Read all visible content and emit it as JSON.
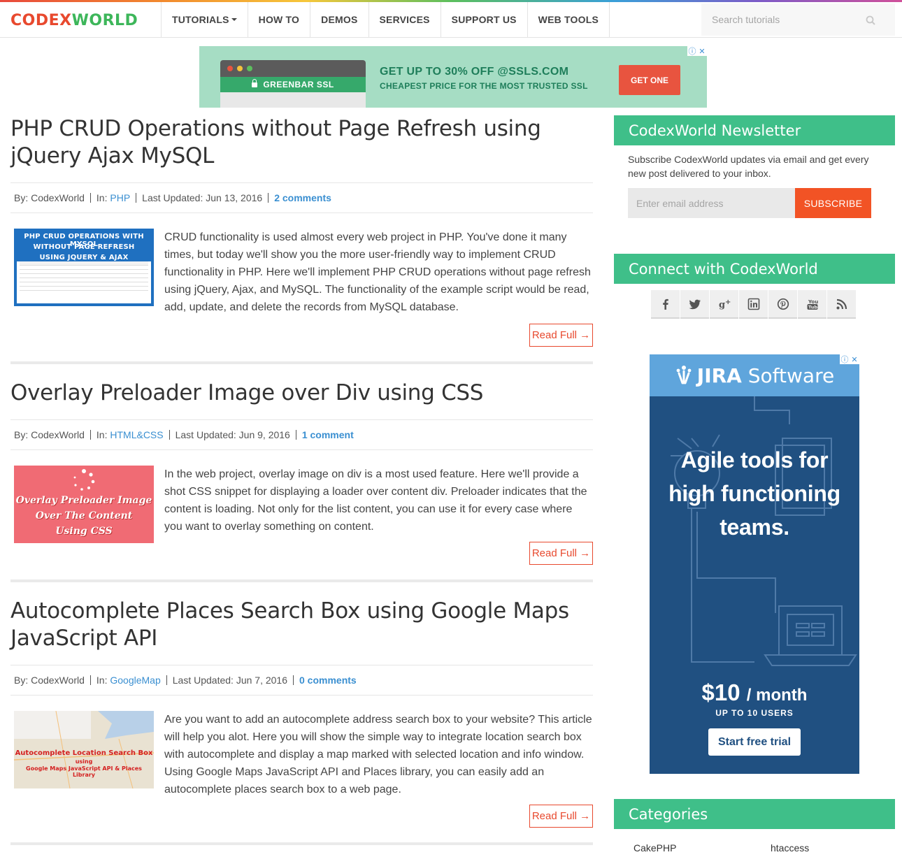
{
  "header": {
    "logo_part1": "CODEX",
    "logo_part2": "WORLD",
    "nav": [
      "TUTORIALS",
      "HOW TO",
      "DEMOS",
      "SERVICES",
      "SUPPORT US",
      "WEB TOOLS"
    ],
    "search_placeholder": "Search tutorials"
  },
  "top_ad": {
    "badge": "GREENBAR SSL",
    "headline": "GET UP TO 30% OFF @SSLS.COM",
    "subline": "CHEAPEST PRICE FOR THE MOST TRUSTED SSL",
    "cta": "GET ONE"
  },
  "posts": [
    {
      "title": "PHP CRUD Operations without Page Refresh using jQuery Ajax MySQL",
      "by_label": "By: CodexWorld",
      "in_label": "In:",
      "category": "PHP",
      "updated": "Last Updated: Jun 13, 2016",
      "comments": "2 comments",
      "excerpt": "CRUD functionality is used almost every web project in PHP. You've done it many times, but today we'll show you the more user-friendly way to implement CRUD functionality in PHP. Here we'll implement PHP CRUD operations without page refresh using jQuery, Ajax, and MySQL. The functionality of the example script would be read, add, update, and delete the records from MySQL database.",
      "thumb_lines": [
        "PHP CRUD OPERATIONS WITH MYSQL",
        "WITHOUT PAGE REFRESH",
        "USING JQUERY & AJAX"
      ],
      "read_more": "Read Full →"
    },
    {
      "title": "Overlay Preloader Image over Div using CSS",
      "by_label": "By: CodexWorld",
      "in_label": "In:",
      "category": "HTML&CSS",
      "updated": "Last Updated: Jun 9, 2016",
      "comments": "1 comment",
      "excerpt": "In the web project, overlay image on div is a most used feature. Here we'll provide a shot CSS snippet for displaying a loader over content div. Preloader indicates that the content is loading. Not only for the list content, you can use it for every case where you want to overlay something on content.",
      "thumb_lines": [
        "Overlay Preloader Image",
        "Over The Content",
        "Using CSS"
      ],
      "read_more": "Read Full →"
    },
    {
      "title": "Autocomplete Places Search Box using Google Maps JavaScript API",
      "by_label": "By: CodexWorld",
      "in_label": "In:",
      "category": "GoogleMap",
      "updated": "Last Updated: Jun 7, 2016",
      "comments": "0 comments",
      "excerpt": "Are you want to add an autocomplete address search box to your website? This article will help you alot. Here you will show the simple way to integrate location search box with autocomplete and display a map marked with selected location and info window. Using Google Maps JavaScript API and Places library, you can easily add an autocomplete places search box to a web page.",
      "thumb_lines": [
        "Autocomplete Location Search Box",
        "using",
        "Google Maps JavaScript API & Places Library"
      ],
      "read_more": "Read Full →"
    }
  ],
  "sidebar": {
    "newsletter_title": "CodexWorld Newsletter",
    "newsletter_text": "Subscribe CodexWorld updates via email and get every new post delivered to your inbox.",
    "email_placeholder": "Enter email address",
    "subscribe_label": "SUBSCRIBE",
    "connect_title": "Connect with CodexWorld",
    "social_icons": [
      "facebook-icon",
      "twitter-icon",
      "google-plus-icon",
      "linkedin-icon",
      "pinterest-icon",
      "youtube-icon",
      "rss-icon"
    ],
    "categories_title": "Categories",
    "categories": [
      "CakePHP",
      "htaccess"
    ]
  },
  "jira_ad": {
    "brand": "JIRA",
    "brand_suffix": "Software",
    "headline_1": "Agile tools for",
    "headline_2": "high functioning",
    "headline_3": "teams.",
    "price": "$10",
    "price_unit": "/ month",
    "users": "UP TO 10 USERS",
    "cta": "Start free trial"
  },
  "colors": {
    "accent_green": "#3fbf89",
    "accent_orange": "#f25325",
    "link_blue": "#3a8fd1",
    "read_more_red": "#e8492e"
  }
}
